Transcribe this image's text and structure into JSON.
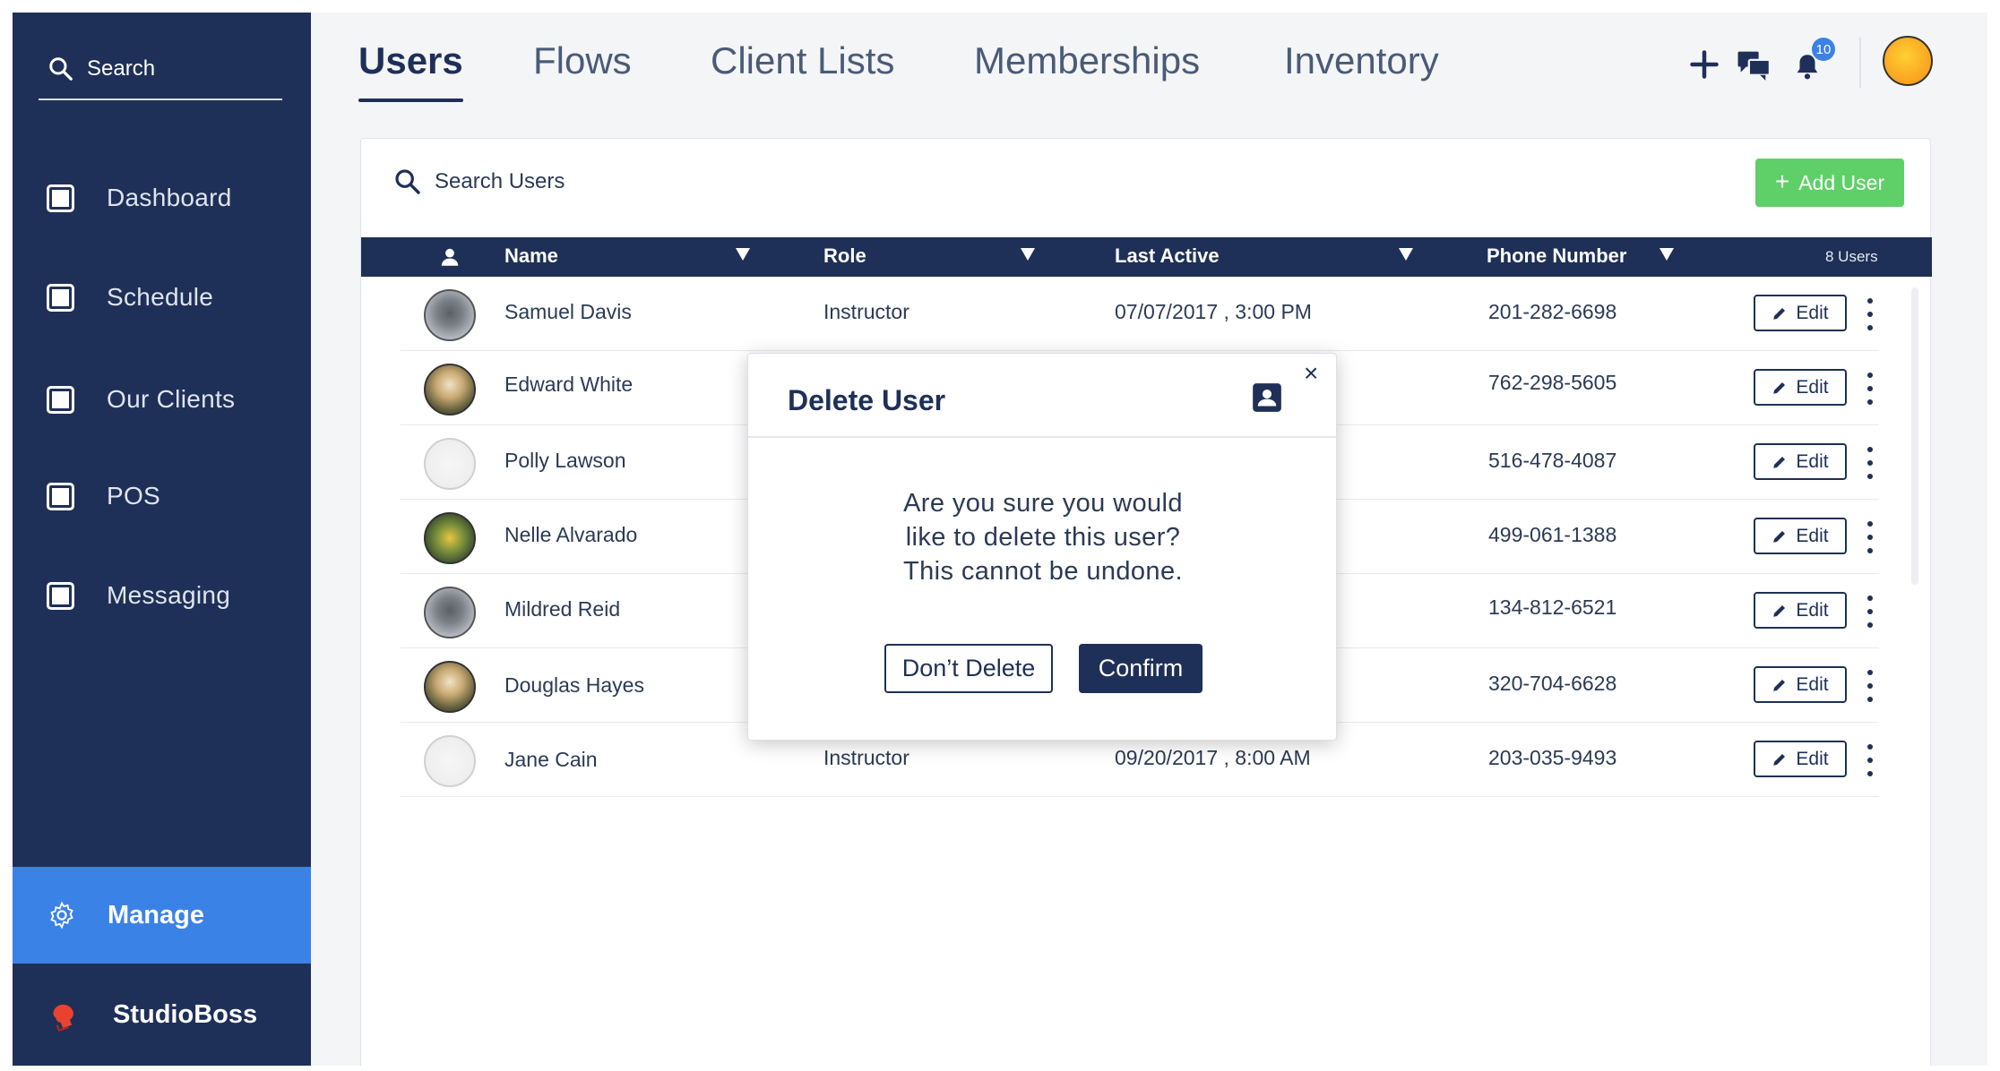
{
  "sidebar": {
    "search_label": "Search",
    "items": [
      {
        "label": "Dashboard"
      },
      {
        "label": "Schedule"
      },
      {
        "label": "Our Clients"
      },
      {
        "label": "POS"
      },
      {
        "label": "Messaging"
      }
    ],
    "manage_label": "Manage",
    "brand_label": "StudioBoss"
  },
  "tabs": [
    {
      "label": "Users",
      "active": true
    },
    {
      "label": "Flows"
    },
    {
      "label": "Client Lists"
    },
    {
      "label": "Memberships"
    },
    {
      "label": "Inventory"
    }
  ],
  "header": {
    "notification_count": "10",
    "icons": [
      "plus-icon",
      "chat-icon",
      "bell-icon",
      "avatar"
    ]
  },
  "users_card": {
    "search_placeholder": "Search Users",
    "add_user_label": "Add User",
    "columns": {
      "name": "Name",
      "role": "Role",
      "last_active": "Last Active",
      "phone": "Phone Number"
    },
    "user_count": "8 Users",
    "edit_label": "Edit",
    "rows": [
      {
        "name": "Samuel Davis",
        "role": "Instructor",
        "last_active": "07/07/2017 , 3:00 PM",
        "phone": "201-282-6698"
      },
      {
        "name": "Edward White",
        "role": "",
        "last_active": "",
        "phone": "762-298-5605"
      },
      {
        "name": "Polly Lawson",
        "role": "",
        "last_active": "",
        "phone": "516-478-4087"
      },
      {
        "name": "Nelle Alvarado",
        "role": "",
        "last_active": "",
        "phone": "499-061-1388"
      },
      {
        "name": "Mildred Reid",
        "role": "",
        "last_active": "",
        "phone": "134-812-6521"
      },
      {
        "name": "Douglas Hayes",
        "role": "",
        "last_active": "",
        "phone": "320-704-6628"
      },
      {
        "name": "Jane Cain",
        "role": "Instructor",
        "last_active": "09/20/2017 , 8:00 AM",
        "phone": "203-035-9493"
      }
    ]
  },
  "modal": {
    "title": "Delete User",
    "close": "×",
    "message_line1": "Are you sure you would",
    "message_line2": "like to delete this user?",
    "message_line3": "This cannot be undone.",
    "cancel_label": "Don’t Delete",
    "confirm_label": "Confirm"
  },
  "colors": {
    "navy": "#1e3057",
    "accent_blue": "#3b82e6",
    "add_green": "#5fd068"
  }
}
